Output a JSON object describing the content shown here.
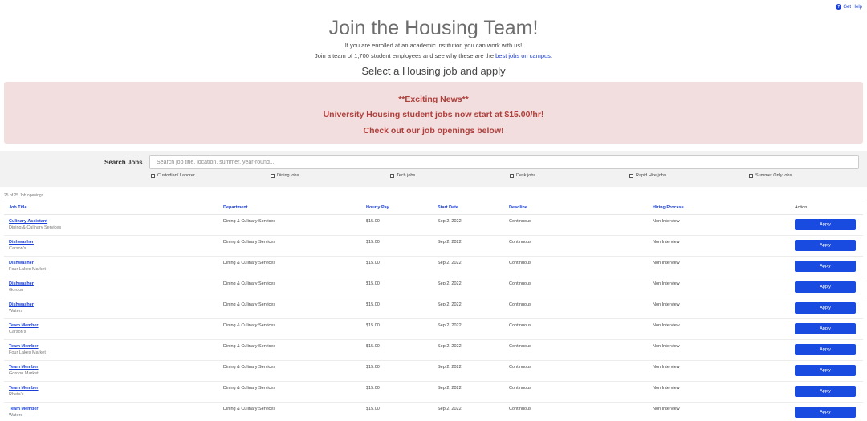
{
  "help": {
    "label": "Get Help"
  },
  "hero": {
    "title": "Join the Housing Team!",
    "line1": "If you are enrolled at an academic institution you can work with us!",
    "line2_prefix": "Join a team of 1,700 student employees and see why these are the ",
    "line2_link": "best jobs on campus",
    "line2_suffix": ".",
    "subtitle": "Select a Housing job and apply"
  },
  "news": {
    "line1": "**Exciting News**",
    "line2": "University Housing student jobs now start at $15.00/hr!",
    "line3": "Check out our job openings below!"
  },
  "search": {
    "label": "Search Jobs",
    "placeholder": "Search job title, location, summer, year-round...",
    "filters": [
      "Custodian/ Laborer",
      "Dining jobs",
      "Tech jobs",
      "Desk jobs",
      "Rapid Hire jobs",
      "Summer Only jobs"
    ]
  },
  "count_text": "25 of 25 Job openings",
  "table": {
    "headers": {
      "job_title": "Job Title",
      "department": "Department",
      "hourly_pay": "Hourly Pay",
      "start_date": "Start Date",
      "deadline": "Deadline",
      "hiring_process": "Hiring Process",
      "action": "Action"
    },
    "apply_label": "Apply",
    "rows": [
      {
        "title": "Culinary Assistant",
        "location": "Dining & Culinary Services",
        "department": "Dining & Culinary Services",
        "pay": "$15.00",
        "start": "Sep 2, 2022",
        "deadline": "Continuous",
        "process": "Non Interview"
      },
      {
        "title": "Dishwasher",
        "location": "Carson's",
        "department": "Dining & Culinary Services",
        "pay": "$15.00",
        "start": "Sep 2, 2022",
        "deadline": "Continuous",
        "process": "Non Interview"
      },
      {
        "title": "Dishwasher",
        "location": "Four Lakes Market",
        "department": "Dining & Culinary Services",
        "pay": "$15.00",
        "start": "Sep 2, 2022",
        "deadline": "Continuous",
        "process": "Non Interview"
      },
      {
        "title": "Dishwasher",
        "location": "Gordon",
        "department": "Dining & Culinary Services",
        "pay": "$15.00",
        "start": "Sep 2, 2022",
        "deadline": "Continuous",
        "process": "Non Interview"
      },
      {
        "title": "Dishwasher",
        "location": "Waters",
        "department": "Dining & Culinary Services",
        "pay": "$15.00",
        "start": "Sep 2, 2022",
        "deadline": "Continuous",
        "process": "Non Interview"
      },
      {
        "title": "Team Member",
        "location": "Carson's",
        "department": "Dining & Culinary Services",
        "pay": "$15.00",
        "start": "Sep 2, 2022",
        "deadline": "Continuous",
        "process": "Non Interview"
      },
      {
        "title": "Team Member",
        "location": "Four Lakes Market",
        "department": "Dining & Culinary Services",
        "pay": "$15.00",
        "start": "Sep 2, 2022",
        "deadline": "Continuous",
        "process": "Non Interview"
      },
      {
        "title": "Team Member",
        "location": "Gordon Market",
        "department": "Dining & Culinary Services",
        "pay": "$15.00",
        "start": "Sep 2, 2022",
        "deadline": "Continuous",
        "process": "Non Interview"
      },
      {
        "title": "Team Member",
        "location": "Rheta's",
        "department": "Dining & Culinary Services",
        "pay": "$15.00",
        "start": "Sep 2, 2022",
        "deadline": "Continuous",
        "process": "Non Interview"
      },
      {
        "title": "Team Member",
        "location": "Waters",
        "department": "Dining & Culinary Services",
        "pay": "$15.00",
        "start": "Sep 2, 2022",
        "deadline": "Continuous",
        "process": "Non Interview"
      }
    ]
  },
  "colors": {
    "link": "#1a3fd6",
    "button": "#1a4be0",
    "news_bg": "#f2dede",
    "news_text": "#b03e3a"
  }
}
